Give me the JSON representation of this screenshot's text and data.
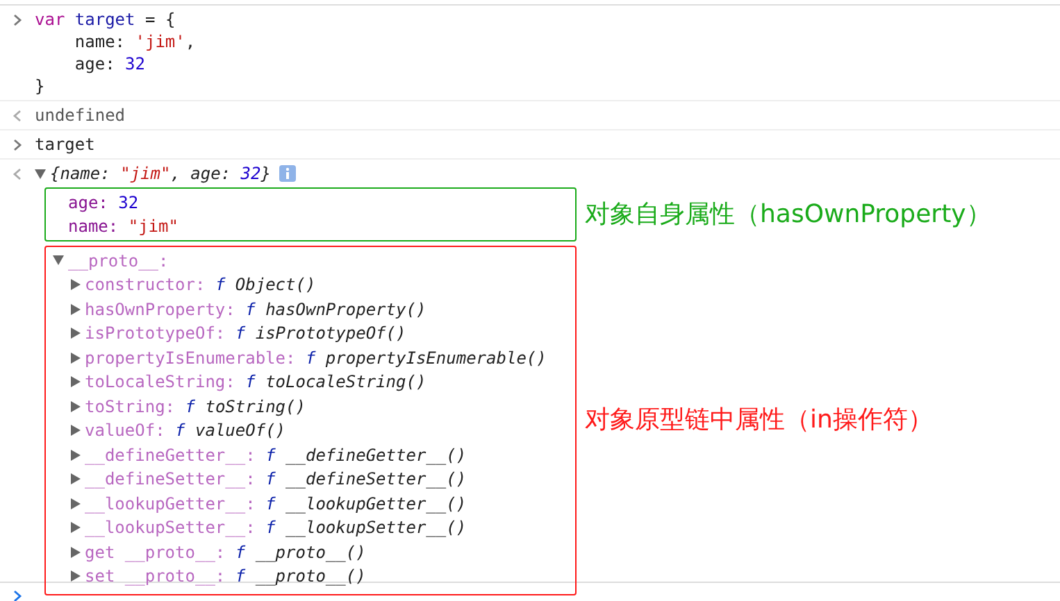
{
  "console": [
    {
      "kind": "input",
      "lines": [
        [
          {
            "text": "var ",
            "kind": "keyword"
          },
          {
            "text": "target",
            "kind": "variable"
          },
          {
            "text": " = {",
            "kind": "plain"
          }
        ],
        [
          {
            "text": "    name: ",
            "kind": "plain"
          },
          {
            "text": "'jim'",
            "kind": "string"
          },
          {
            "text": ",",
            "kind": "plain"
          }
        ],
        [
          {
            "text": "    age: ",
            "kind": "plain"
          },
          {
            "text": "32",
            "kind": "number"
          }
        ],
        [
          {
            "text": "}",
            "kind": "plain"
          }
        ]
      ]
    },
    {
      "kind": "result",
      "text": "undefined"
    },
    {
      "kind": "input",
      "lines": [
        [
          {
            "text": "target",
            "kind": "plain"
          }
        ]
      ]
    },
    {
      "kind": "object",
      "expanded": true,
      "preview": [
        {
          "text": "{name: ",
          "kind": "plain"
        },
        {
          "text": "\"jim\"",
          "kind": "string"
        },
        {
          "text": ", age: ",
          "kind": "plain"
        },
        {
          "text": "32",
          "kind": "number"
        },
        {
          "text": "}",
          "kind": "plain"
        }
      ],
      "own": [
        {
          "key": "age:",
          "value": "32",
          "kind": "number"
        },
        {
          "key": "name:",
          "value": "\"jim\"",
          "kind": "string"
        }
      ],
      "proto": {
        "key": "__proto__:",
        "expanded": true,
        "members": [
          {
            "key": "constructor:",
            "fn": "f",
            "value": "Object()",
            "expanded": false
          },
          {
            "key": "hasOwnProperty:",
            "fn": "f",
            "value": "hasOwnProperty()",
            "expanded": false
          },
          {
            "key": "isPrototypeOf:",
            "fn": "f",
            "value": "isPrototypeOf()",
            "expanded": false
          },
          {
            "key": "propertyIsEnumerable:",
            "fn": "f",
            "value": "propertyIsEnumerable()",
            "expanded": false
          },
          {
            "key": "toLocaleString:",
            "fn": "f",
            "value": "toLocaleString()",
            "expanded": false
          },
          {
            "key": "toString:",
            "fn": "f",
            "value": "toString()",
            "expanded": false
          },
          {
            "key": "valueOf:",
            "fn": "f",
            "value": "valueOf()",
            "expanded": false
          },
          {
            "key": "__defineGetter__:",
            "fn": "f",
            "value": "__defineGetter__()",
            "expanded": false
          },
          {
            "key": "__defineSetter__:",
            "fn": "f",
            "value": "__defineSetter__()",
            "expanded": false
          },
          {
            "key": "__lookupGetter__:",
            "fn": "f",
            "value": "__lookupGetter__()",
            "expanded": false
          },
          {
            "key": "__lookupSetter__:",
            "fn": "f",
            "value": "__lookupSetter__()",
            "expanded": false
          },
          {
            "key": "get __proto__:",
            "fn": "f",
            "value": "__proto__()",
            "expanded": false
          },
          {
            "key": "set __proto__:",
            "fn": "f",
            "value": "__proto__()",
            "expanded": false
          }
        ]
      },
      "annotations": [
        {
          "text": "对象自身属性（hasOwnProperty）",
          "color": "#1aab1a"
        },
        {
          "text": "对象原型链中属性（in操作符）",
          "color": "#ff1a1a"
        }
      ]
    },
    {
      "kind": "prompt"
    }
  ]
}
